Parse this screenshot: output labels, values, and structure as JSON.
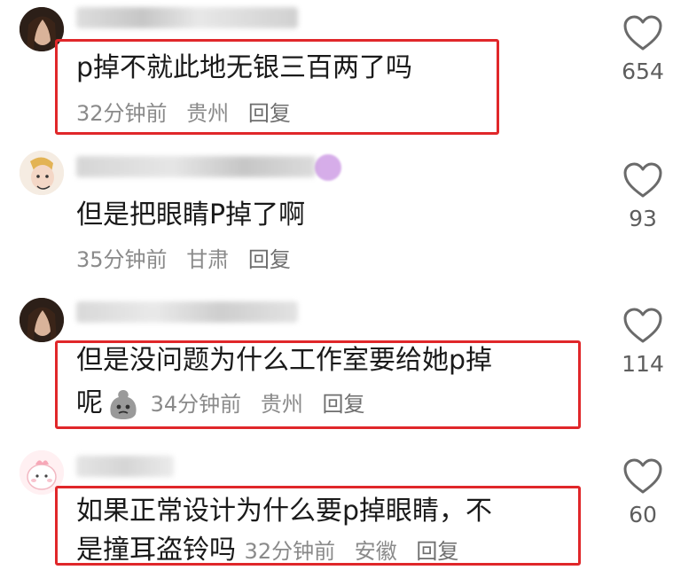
{
  "comments": [
    {
      "text": "p掉不就此地无银三百两了吗",
      "time": "32分钟前",
      "location": "贵州",
      "reply_label": "回复",
      "likes": "654"
    },
    {
      "text": "但是把眼睛P掉了啊",
      "time": "35分钟前",
      "location": "甘肃",
      "reply_label": "回复",
      "likes": "93"
    },
    {
      "text_line1": "但是没问题为什么工作室要给她p掉",
      "text_line2": "呢",
      "time": "34分钟前",
      "location": "贵州",
      "reply_label": "回复",
      "likes": "114"
    },
    {
      "text_line1": "如果正常设计为什么要p掉眼睛，不",
      "text_line2": "是撞耳盗铃吗",
      "time": "32分钟前",
      "location": "安徽",
      "reply_label": "回复",
      "likes": "60"
    }
  ],
  "colors": {
    "highlight": "#e0272a",
    "text": "#1a1a1a",
    "meta": "#8a8a8a",
    "like_icon": "#6a6a6a"
  },
  "icons": {
    "like": "heart-outline-icon",
    "emoji": "gray-blob-emoji-icon"
  }
}
